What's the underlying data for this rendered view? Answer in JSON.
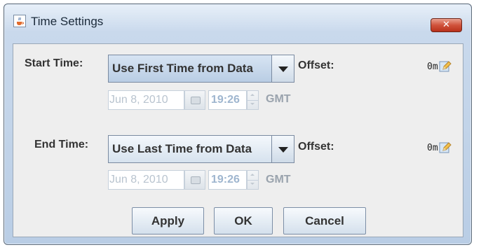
{
  "window": {
    "title": "Time Settings",
    "close_glyph": "✕"
  },
  "icons": {
    "app": "java-cup-icon",
    "close": "close-icon",
    "edit": "pencil-edit-icon"
  },
  "start": {
    "label": "Start Time:",
    "mode": "Use First Time from Data",
    "offset_label": "Offset:",
    "offset_value": "0m",
    "date": "Jun 8, 2010",
    "time": "19:26",
    "timezone": "GMT"
  },
  "end": {
    "label": "End Time:",
    "mode": "Use Last Time from Data",
    "offset_label": "Offset:",
    "offset_value": "0m",
    "date": "Jun 8, 2010",
    "time": "19:26",
    "timezone": "GMT"
  },
  "buttons": {
    "apply": "Apply",
    "ok": "OK",
    "cancel": "Cancel"
  },
  "colors": {
    "close_button": "#c63e27",
    "disabled_text": "#b9c4cf"
  }
}
